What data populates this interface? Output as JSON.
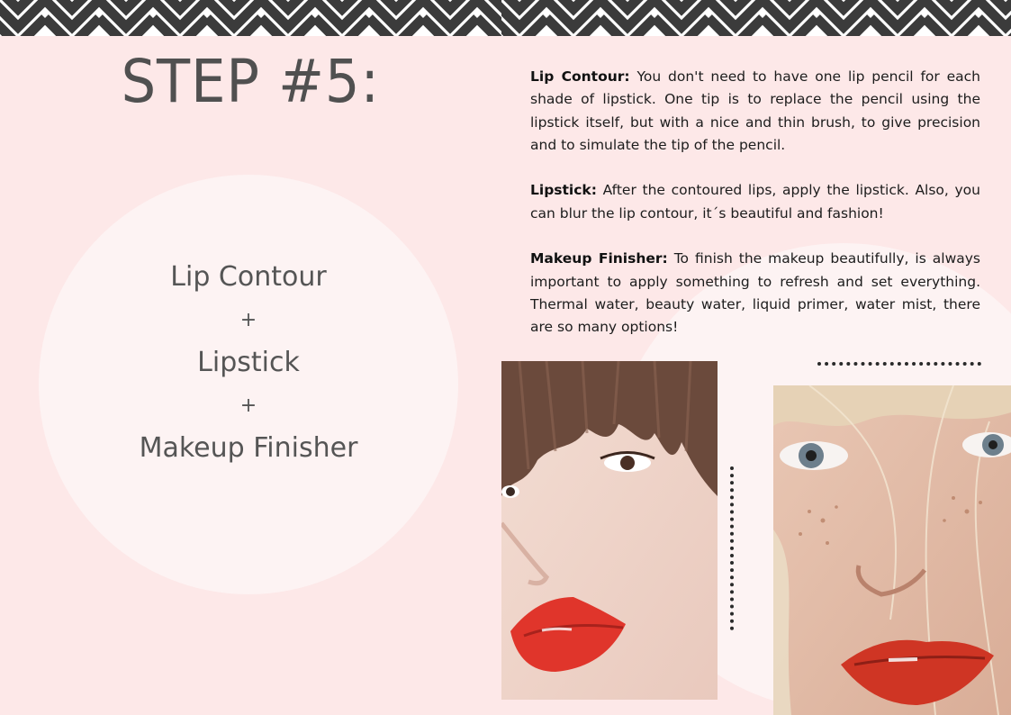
{
  "left_page": {
    "title": "STEP #5:",
    "steps": {
      "step1": "Lip Contour",
      "plus1": "+",
      "step2": "Lipstick",
      "plus2": "+",
      "step3": "Makeup Finisher"
    }
  },
  "right_page": {
    "paragraphs": [
      {
        "heading": "Lip Contour:",
        "body": " You don't need to have one lip pencil for each shade of lipstick. One tip is to replace the pencil using the lipstick itself, but with a nice and thin brush, to give precision and to simulate the tip of the pencil."
      },
      {
        "heading": "Lipstick:",
        "body": " After the contoured lips, apply the lipstick. Also, you can blur the lip contour, it´s beautiful and fashion!"
      },
      {
        "heading": "Makeup Finisher:",
        "body": " To finish the makeup beautifully, is always important to apply something to refresh and set everything. Thermal water, beauty water, liquid primer, water mist, there are so many options!"
      }
    ],
    "photos": {
      "photo1": "model-with-fringe-red-lips",
      "photo2": "blonde-model-freckles-red-lips"
    }
  },
  "colors": {
    "background": "#fde8e8",
    "circle": "#fdf3f3",
    "stripes": "#3b3b3b",
    "title_text": "#505050",
    "body_text": "#1c1c1c",
    "lip_red": "#e0352b"
  }
}
